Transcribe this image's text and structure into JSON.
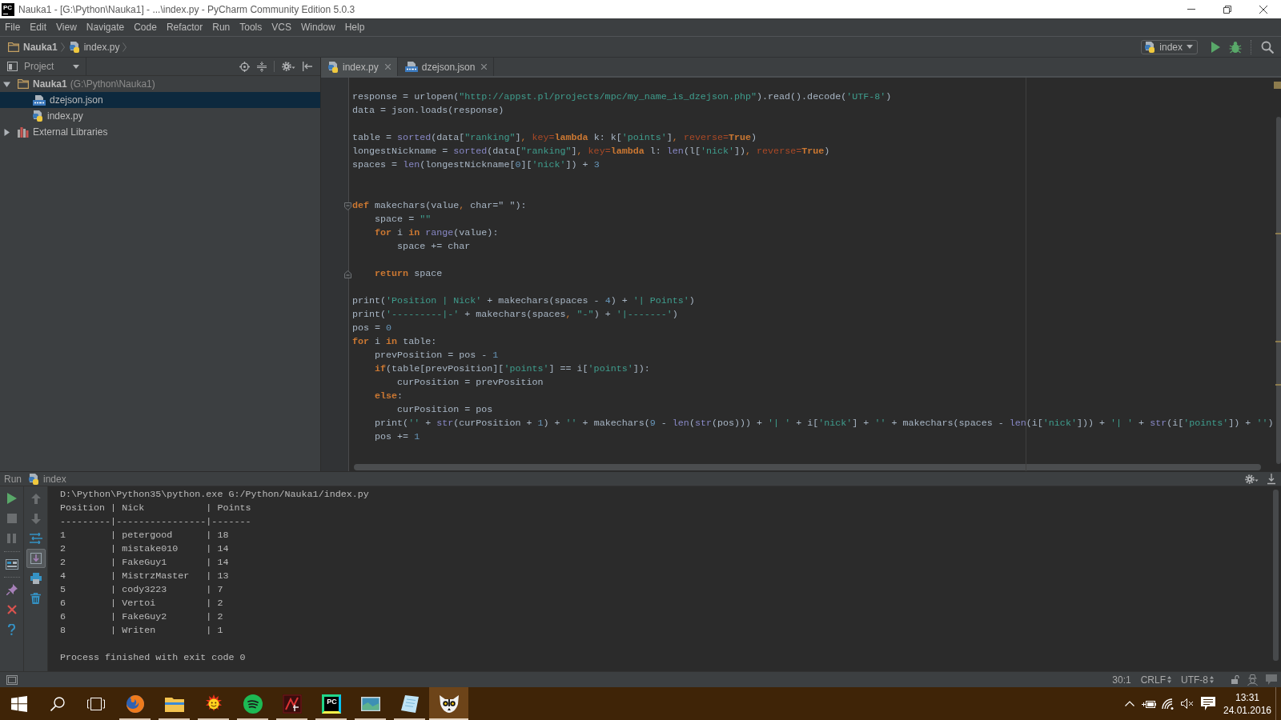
{
  "title_bar": {
    "app_logo": "PC",
    "title": "Nauka1 - [G:\\Python\\Nauka1] - ...\\index.py - PyCharm Community Edition 5.0.3"
  },
  "menu": [
    "File",
    "Edit",
    "View",
    "Navigate",
    "Code",
    "Refactor",
    "Run",
    "Tools",
    "VCS",
    "Window",
    "Help"
  ],
  "navigation_bar": {
    "breadcrumbs": [
      {
        "label": "Nauka1",
        "kind": "project"
      },
      {
        "label": "index.py",
        "kind": "python"
      }
    ],
    "run_configuration": "index"
  },
  "project_panel": {
    "title": "Project",
    "tree": [
      {
        "label": "Nauka1",
        "path": "(G:\\Python\\Nauka1)",
        "kind": "project",
        "expanded": true,
        "selected": false,
        "children": [
          {
            "label": "dzejson.json",
            "kind": "json",
            "selected": true
          },
          {
            "label": "index.py",
            "kind": "python",
            "selected": false
          }
        ]
      },
      {
        "label": "External Libraries",
        "kind": "library",
        "expanded": false,
        "selected": false
      }
    ]
  },
  "editor": {
    "tabs": [
      {
        "label": "index.py",
        "kind": "python",
        "selected": true
      },
      {
        "label": "dzejson.json",
        "kind": "json",
        "selected": false
      }
    ],
    "lines": [
      {
        "kind": "code",
        "tokens": [
          {
            "text": "response = urlopen(",
            "kind": "plain"
          },
          {
            "text": "\"http://appst.pl/projects/mpc/my_name_is_dzejson.php\"",
            "kind": "string"
          },
          {
            "text": ").read().decode(",
            "kind": "plain"
          },
          {
            "text": "'UTF-8'",
            "kind": "string"
          },
          {
            "text": ")",
            "kind": "plain"
          }
        ]
      },
      {
        "kind": "code",
        "tokens": [
          {
            "text": "data = json.loads(response)",
            "kind": "plain"
          }
        ]
      },
      {
        "kind": "blank"
      },
      {
        "kind": "code",
        "tokens": [
          {
            "text": "table = ",
            "kind": "plain"
          },
          {
            "text": "sorted",
            "kind": "builtin"
          },
          {
            "text": "(data[",
            "kind": "plain"
          },
          {
            "text": "\"ranking\"",
            "kind": "string"
          },
          {
            "text": "]",
            "kind": "plain"
          },
          {
            "text": ", ",
            "kind": "comma"
          },
          {
            "text": "key=",
            "kind": "param"
          },
          {
            "text": "lambda",
            "kind": "keyword"
          },
          {
            "text": " k: k[",
            "kind": "plain"
          },
          {
            "text": "'points'",
            "kind": "string"
          },
          {
            "text": "]",
            "kind": "plain"
          },
          {
            "text": ", ",
            "kind": "comma"
          },
          {
            "text": "reverse=",
            "kind": "param"
          },
          {
            "text": "True",
            "kind": "keyword"
          },
          {
            "text": ")",
            "kind": "plain"
          }
        ]
      },
      {
        "kind": "code",
        "tokens": [
          {
            "text": "longestNickname = ",
            "kind": "plain"
          },
          {
            "text": "sorted",
            "kind": "builtin"
          },
          {
            "text": "(data[",
            "kind": "plain"
          },
          {
            "text": "\"ranking\"",
            "kind": "string"
          },
          {
            "text": "]",
            "kind": "plain"
          },
          {
            "text": ", ",
            "kind": "comma"
          },
          {
            "text": "key=",
            "kind": "param"
          },
          {
            "text": "lambda",
            "kind": "keyword"
          },
          {
            "text": " l: ",
            "kind": "plain"
          },
          {
            "text": "len",
            "kind": "builtin"
          },
          {
            "text": "(l[",
            "kind": "plain"
          },
          {
            "text": "'nick'",
            "kind": "string"
          },
          {
            "text": "])",
            "kind": "plain"
          },
          {
            "text": ", ",
            "kind": "comma"
          },
          {
            "text": "reverse=",
            "kind": "param"
          },
          {
            "text": "True",
            "kind": "keyword"
          },
          {
            "text": ")",
            "kind": "plain"
          }
        ]
      },
      {
        "kind": "code",
        "tokens": [
          {
            "text": "spaces = ",
            "kind": "plain"
          },
          {
            "text": "len",
            "kind": "builtin"
          },
          {
            "text": "(longestNickname[",
            "kind": "plain"
          },
          {
            "text": "0",
            "kind": "number"
          },
          {
            "text": "][",
            "kind": "plain"
          },
          {
            "text": "'nick'",
            "kind": "string"
          },
          {
            "text": "]) + ",
            "kind": "plain"
          },
          {
            "text": "3",
            "kind": "number"
          }
        ]
      },
      {
        "kind": "blank"
      },
      {
        "kind": "blank"
      },
      {
        "kind": "fold_start",
        "tokens": [
          {
            "text": "def",
            "kind": "keyword"
          },
          {
            "text": " makechars(value",
            "kind": "plain"
          },
          {
            "text": ", ",
            "kind": "comma"
          },
          {
            "text": "char=\" \"):",
            "kind": "plain"
          }
        ]
      },
      {
        "kind": "code",
        "tokens": [
          {
            "text": "    space = ",
            "kind": "plain"
          },
          {
            "text": "\"\"",
            "kind": "string"
          }
        ]
      },
      {
        "kind": "code",
        "tokens": [
          {
            "text": "    for",
            "kind": "keyword"
          },
          {
            "text": " i ",
            "kind": "plain"
          },
          {
            "text": "in",
            "kind": "keyword"
          },
          {
            "text": " range",
            "kind": "builtin"
          },
          {
            "text": "(value):",
            "kind": "plain"
          }
        ]
      },
      {
        "kind": "code",
        "tokens": [
          {
            "text": "        space += char",
            "kind": "plain"
          }
        ]
      },
      {
        "kind": "blank"
      },
      {
        "kind": "fold_end",
        "tokens": [
          {
            "text": "    return",
            "kind": "keyword"
          },
          {
            "text": " space",
            "kind": "plain"
          }
        ]
      },
      {
        "kind": "blank"
      },
      {
        "kind": "code",
        "tokens": [
          {
            "text": "print(",
            "kind": "plain"
          },
          {
            "text": "'Position | Nick'",
            "kind": "string"
          },
          {
            "text": " + makechars(spaces - ",
            "kind": "plain"
          },
          {
            "text": "4",
            "kind": "number"
          },
          {
            "text": ") + ",
            "kind": "plain"
          },
          {
            "text": "'| Points'",
            "kind": "string"
          },
          {
            "text": ")",
            "kind": "plain"
          }
        ]
      },
      {
        "kind": "code",
        "tokens": [
          {
            "text": "print(",
            "kind": "plain"
          },
          {
            "text": "'---------|-'",
            "kind": "string"
          },
          {
            "text": " + makechars(spaces",
            "kind": "plain"
          },
          {
            "text": ", ",
            "kind": "comma"
          },
          {
            "text": "\"-\"",
            "kind": "string"
          },
          {
            "text": ") + ",
            "kind": "plain"
          },
          {
            "text": "'|-------'",
            "kind": "string"
          },
          {
            "text": ")",
            "kind": "plain"
          }
        ]
      },
      {
        "kind": "code",
        "tokens": [
          {
            "text": "pos = ",
            "kind": "plain"
          },
          {
            "text": "0",
            "kind": "number"
          }
        ]
      },
      {
        "kind": "code",
        "tokens": [
          {
            "text": "for",
            "kind": "keyword"
          },
          {
            "text": " i ",
            "kind": "plain"
          },
          {
            "text": "in",
            "kind": "keyword"
          },
          {
            "text": " table:",
            "kind": "plain"
          }
        ]
      },
      {
        "kind": "code",
        "tokens": [
          {
            "text": "    prevPosition = pos - ",
            "kind": "plain"
          },
          {
            "text": "1",
            "kind": "number"
          }
        ]
      },
      {
        "kind": "code",
        "tokens": [
          {
            "text": "    if",
            "kind": "keyword"
          },
          {
            "text": "(table[prevPosition][",
            "kind": "plain"
          },
          {
            "text": "'points'",
            "kind": "string"
          },
          {
            "text": "] == i[",
            "kind": "plain"
          },
          {
            "text": "'points'",
            "kind": "string"
          },
          {
            "text": "]):",
            "kind": "plain"
          }
        ]
      },
      {
        "kind": "code",
        "tokens": [
          {
            "text": "        curPosition = prevPosition",
            "kind": "plain"
          }
        ]
      },
      {
        "kind": "code",
        "tokens": [
          {
            "text": "    else",
            "kind": "keyword"
          },
          {
            "text": ":",
            "kind": "plain"
          }
        ]
      },
      {
        "kind": "code",
        "tokens": [
          {
            "text": "        curPosition = pos",
            "kind": "plain"
          }
        ]
      },
      {
        "kind": "code",
        "tokens": [
          {
            "text": "    print(",
            "kind": "plain"
          },
          {
            "text": "''",
            "kind": "string"
          },
          {
            "text": " + ",
            "kind": "plain"
          },
          {
            "text": "str",
            "kind": "builtin"
          },
          {
            "text": "(curPosition + ",
            "kind": "plain"
          },
          {
            "text": "1",
            "kind": "number"
          },
          {
            "text": ") + ",
            "kind": "plain"
          },
          {
            "text": "''",
            "kind": "string"
          },
          {
            "text": " + makechars(",
            "kind": "plain"
          },
          {
            "text": "9",
            "kind": "number"
          },
          {
            "text": " - ",
            "kind": "plain"
          },
          {
            "text": "len",
            "kind": "builtin"
          },
          {
            "text": "(",
            "kind": "plain"
          },
          {
            "text": "str",
            "kind": "builtin"
          },
          {
            "text": "(pos))) + ",
            "kind": "plain"
          },
          {
            "text": "'| '",
            "kind": "string"
          },
          {
            "text": " + i[",
            "kind": "plain"
          },
          {
            "text": "'nick'",
            "kind": "string"
          },
          {
            "text": "] + ",
            "kind": "plain"
          },
          {
            "text": "''",
            "kind": "string"
          },
          {
            "text": " + makechars(spaces - ",
            "kind": "plain"
          },
          {
            "text": "len",
            "kind": "builtin"
          },
          {
            "text": "(i[",
            "kind": "plain"
          },
          {
            "text": "'nick'",
            "kind": "string"
          },
          {
            "text": "])) + ",
            "kind": "plain"
          },
          {
            "text": "'| '",
            "kind": "string"
          },
          {
            "text": " + ",
            "kind": "plain"
          },
          {
            "text": "str",
            "kind": "builtin"
          },
          {
            "text": "(i[",
            "kind": "plain"
          },
          {
            "text": "'points'",
            "kind": "string"
          },
          {
            "text": "]) + ",
            "kind": "plain"
          },
          {
            "text": "''",
            "kind": "string"
          },
          {
            "text": ")",
            "kind": "plain"
          }
        ]
      },
      {
        "kind": "code",
        "tokens": [
          {
            "text": "    pos += ",
            "kind": "plain"
          },
          {
            "text": "1",
            "kind": "number"
          }
        ]
      }
    ]
  },
  "run_panel": {
    "title": "Run",
    "configuration": "index",
    "toolbar": {
      "groups": [
        {
          "items": [
            {
              "kind": "rerun",
              "disabled": false
            },
            {
              "kind": "stop",
              "disabled": true
            },
            {
              "kind": "pause",
              "disabled": true
            }
          ]
        },
        {
          "items": [
            {
              "kind": "layout",
              "disabled": false
            }
          ]
        },
        {
          "items": [
            {
              "kind": "pin",
              "disabled": false
            },
            {
              "kind": "close",
              "disabled": false
            },
            {
              "kind": "help",
              "disabled": false
            }
          ]
        }
      ]
    },
    "console_toolbar": [
      {
        "kind": "previous",
        "disabled": true,
        "on": false
      },
      {
        "kind": "next",
        "disabled": true,
        "on": false
      },
      {
        "kind": "soft_wrap",
        "disabled": false,
        "on": false
      },
      {
        "kind": "scroll_to_end",
        "disabled": false,
        "on": true
      },
      {
        "kind": "print",
        "disabled": false,
        "on": false
      },
      {
        "kind": "clear",
        "disabled": false,
        "on": false
      }
    ],
    "output_lines": [
      "D:\\Python\\Python35\\python.exe G:/Python/Nauka1/index.py",
      "Position | Nick           | Points",
      "---------|----------------|-------",
      "1        | petergood      | 18",
      "2        | mistake010     | 14",
      "2        | FakeGuy1       | 14",
      "4        | MistrzMaster   | 13",
      "5        | cody3223       | 7",
      "6        | Vertoi         | 2",
      "6        | FakeGuy2       | 2",
      "8        | Writen         | 1"
    ],
    "exit_message": "Process finished with exit code 0"
  },
  "status_bar": {
    "caret": "30:1",
    "line_separator": "CRLF",
    "encoding": "UTF-8"
  },
  "taskbar": {
    "apps": [
      {
        "kind": "browser",
        "running": true,
        "selected": false
      },
      {
        "kind": "files",
        "running": true,
        "selected": false
      },
      {
        "kind": "sun",
        "running": true,
        "selected": false
      },
      {
        "kind": "music",
        "running": true,
        "selected": false
      },
      {
        "kind": "game",
        "running": true,
        "selected": false
      },
      {
        "kind": "ide",
        "logo_text": "PC",
        "running": true,
        "selected": false
      },
      {
        "kind": "screen",
        "running": true,
        "selected": false
      },
      {
        "kind": "notes",
        "running": true,
        "selected": false
      },
      {
        "kind": "lemur",
        "running": true,
        "selected": true
      }
    ],
    "time": "13:31",
    "date": "24.01.2016"
  }
}
